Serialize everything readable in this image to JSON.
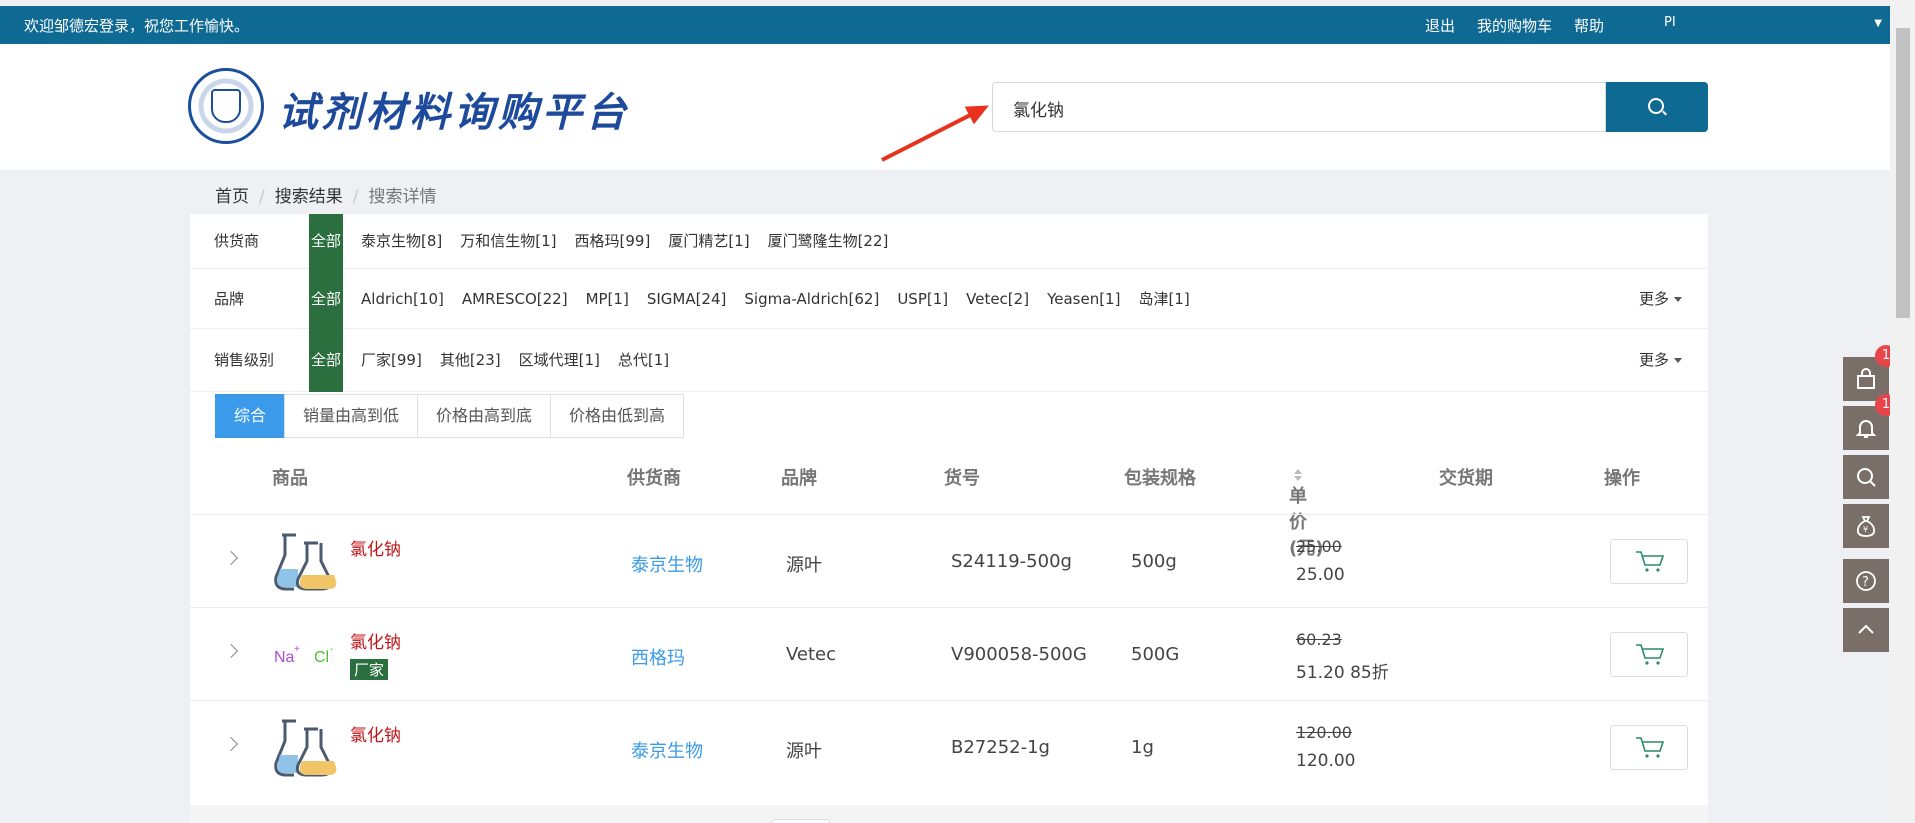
{
  "topbar": {
    "welcome": "欢迎邹德宏登录，祝您工作愉快。",
    "links": [
      "退出",
      "我的购物车",
      "帮助",
      "PI"
    ]
  },
  "header": {
    "brand": "试剂材料询购平台",
    "search_value": "氯化钠"
  },
  "breadcrumb": [
    "首页",
    "搜索结果",
    "搜索详情"
  ],
  "filters": [
    {
      "label": "供货商",
      "all": "全部",
      "items": [
        "泰京生物[8]",
        "万和信生物[1]",
        "西格玛[99]",
        "厦门精艺[1]",
        "厦门鹭隆生物[22]"
      ],
      "more": ""
    },
    {
      "label": "品牌",
      "all": "全部",
      "items": [
        "Aldrich[10]",
        "AMRESCO[22]",
        "MP[1]",
        "SIGMA[24]",
        "Sigma-Aldrich[62]",
        "USP[1]",
        "Vetec[2]",
        "Yeasen[1]",
        "岛津[1]"
      ],
      "more": "更多"
    },
    {
      "label": "销售级别",
      "all": "全部",
      "items": [
        "厂家[99]",
        "其他[23]",
        "区域代理[1]",
        "总代[1]"
      ],
      "more": "更多"
    }
  ],
  "sort_tabs": [
    "综合",
    "销量由高到低",
    "价格由高到底",
    "价格由低到高"
  ],
  "columns": {
    "product": "商品",
    "supplier": "供货商",
    "brand": "品牌",
    "code": "货号",
    "pack": "包装规格",
    "price": "单价(元)",
    "delivery": "交货期",
    "action": "操作"
  },
  "rows": [
    {
      "name": "氯化钠",
      "tag": "",
      "image": "flask",
      "supplier": "泰京生物",
      "brand": "源叶",
      "code": "S24119-500g",
      "pack": "500g",
      "old_price": "25.00",
      "price": "25.00"
    },
    {
      "name": "氯化钠",
      "tag": "厂家",
      "image": "nacl",
      "supplier": "西格玛",
      "brand": "Vetec",
      "code": "V900058-500G",
      "pack": "500G",
      "old_price": "60.23",
      "price": "51.20 85折"
    },
    {
      "name": "氯化钠",
      "tag": "",
      "image": "flask",
      "supplier": "泰京生物",
      "brand": "源叶",
      "code": "B27252-1g",
      "pack": "1g",
      "old_price": "120.00",
      "price": "120.00"
    }
  ],
  "sidebar": {
    "cart_badge": "1",
    "bell_badge": "1"
  },
  "colors": {
    "primary": "#0f6a93",
    "tag_green": "#2c6f3f",
    "link_blue": "#3b9bea",
    "product_red": "#c0161a",
    "arrow_red": "#e8321e"
  }
}
